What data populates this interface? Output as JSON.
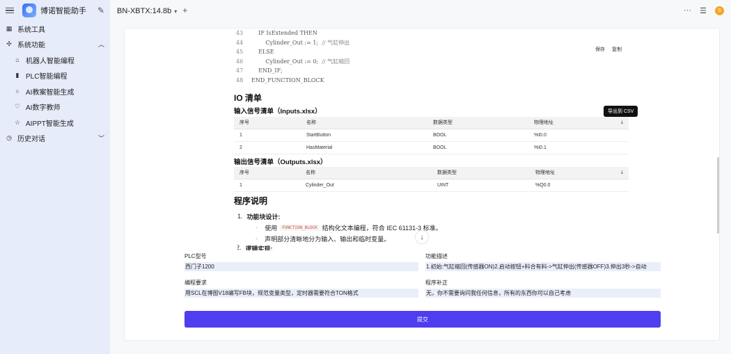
{
  "sidebar": {
    "app_title": "博诺智能助手",
    "items": [
      {
        "label": "系统工具",
        "icon": "grid-icon"
      },
      {
        "label": "系统功能",
        "icon": "puzzle-icon"
      },
      {
        "label": "机器人智能编程",
        "icon": "robot-icon"
      },
      {
        "label": "PLC智能编程",
        "icon": "plc-icon"
      },
      {
        "label": "AI教案智能生成",
        "icon": "circle-icon"
      },
      {
        "label": "AI数字教师",
        "icon": "heart-icon"
      },
      {
        "label": "AIPPT智能生成",
        "icon": "star-icon"
      },
      {
        "label": "历史对话",
        "icon": "clock-icon"
      }
    ]
  },
  "topbar": {
    "model": "BN-XBTX:14.8b",
    "user_initial": "S"
  },
  "code": {
    "lines": [
      {
        "num": "43",
        "text": "    IF IsExtended THEN",
        "comment": ""
      },
      {
        "num": "44",
        "text": "        Cylinder_Out := 1;  ",
        "comment": "// 气缸伸出"
      },
      {
        "num": "45",
        "text": "    ELSE",
        "comment": ""
      },
      {
        "num": "46",
        "text": "        Cylinder_Out := 0;  ",
        "comment": "// 气缸缩回"
      },
      {
        "num": "47",
        "text": "    END_IF;",
        "comment": ""
      },
      {
        "num": "48",
        "text": "END_FUNCTION_BLOCK",
        "comment": ""
      }
    ],
    "save_label": "保存",
    "copy_label": "复制"
  },
  "io": {
    "title": "IO 清单",
    "inputs_title": "输入信号清单（Inputs.xlsx）",
    "outputs_title": "输出信号清单（Outputs.xlsx）",
    "export_tooltip": "导出到 CSV",
    "headers": [
      "序号",
      "名称",
      "数据类型",
      "物理地址"
    ],
    "inputs": [
      [
        "1",
        "StartButton",
        "BOOL",
        "%I0.0"
      ],
      [
        "2",
        "HasMaterial",
        "BOOL",
        "%I0.1"
      ]
    ],
    "outputs": [
      [
        "1",
        "Cylinder_Out",
        "UINT",
        "%Q0.0"
      ]
    ]
  },
  "program": {
    "title": "程序说明",
    "item1_num": "1.",
    "item1_title": "功能块设计:",
    "bullet1_pre": "使用",
    "bullet1_code": "FUNCTION_BLOCK",
    "bullet1_post": "结构化文本编程，符合 IEC 61131-3 标准。",
    "bullet2": "声明部分清晰地分为输入、输出和临时变量。",
    "item2_num": "2.",
    "item2_title": "逻辑实现:"
  },
  "form": {
    "plc_label": "PLC型号",
    "plc_value": "西门子1200",
    "func_label": "功能描述",
    "func_value": "1.初始:气缸缩回(传感器ON)2.启动按钮+料合有料->气缸伸出(传感器OFF)3.伸出3秒->自动",
    "req_label": "编程要求",
    "req_value": "用SCL在博图V18编写FB块，规范变量类型，定时器需要符合TON格式",
    "supp_label": "程序补正",
    "supp_value": "无，你不需要询问我任何信息，所有的东西你可以自己考虑",
    "submit_label": "提交"
  }
}
